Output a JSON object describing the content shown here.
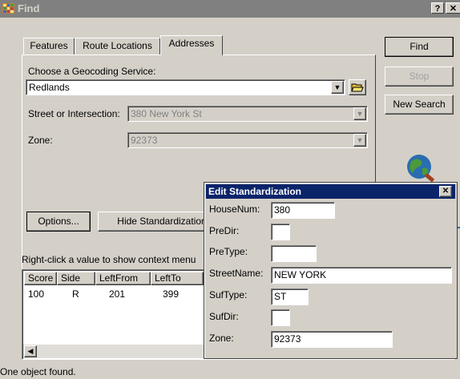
{
  "window": {
    "title": "Find",
    "help_glyph": "?",
    "close_glyph": "✕"
  },
  "tabs": [
    {
      "label": "Features"
    },
    {
      "label": "Route Locations"
    },
    {
      "label": "Addresses"
    }
  ],
  "geocoding": {
    "label": "Choose a Geocoding Service:",
    "value": "Redlands"
  },
  "street": {
    "label": "Street or Intersection:",
    "value": "380 New York St"
  },
  "zone": {
    "label": "Zone:",
    "value": "92373"
  },
  "buttons": {
    "find": "Find",
    "stop": "Stop",
    "new_search": "New Search",
    "options": "Options...",
    "hide_standardization": "Hide Standardization"
  },
  "hint": "Right-click a value to show context menu",
  "results": {
    "columns": [
      "Score",
      "Side",
      "LeftFrom",
      "LeftTo"
    ],
    "rows": [
      [
        "100",
        "R",
        "201",
        "399"
      ]
    ]
  },
  "status": "One object found.",
  "edit_dialog": {
    "title": "Edit Standardization",
    "close_glyph": "✕",
    "fields": {
      "housenum": {
        "label": "HouseNum:",
        "value": "380"
      },
      "predir": {
        "label": "PreDir:",
        "value": ""
      },
      "pretype": {
        "label": "PreType:",
        "value": ""
      },
      "streetname": {
        "label": "StreetName:",
        "value": "NEW YORK"
      },
      "suftype": {
        "label": "SufType:",
        "value": "ST"
      },
      "sufdir": {
        "label": "SufDir:",
        "value": ""
      },
      "zone": {
        "label": "Zone:",
        "value": "92373"
      }
    }
  },
  "colors": {
    "dialog_title_bg": "#0a246a",
    "inactive_title_bg": "#808080",
    "face": "#d4d0c8"
  }
}
